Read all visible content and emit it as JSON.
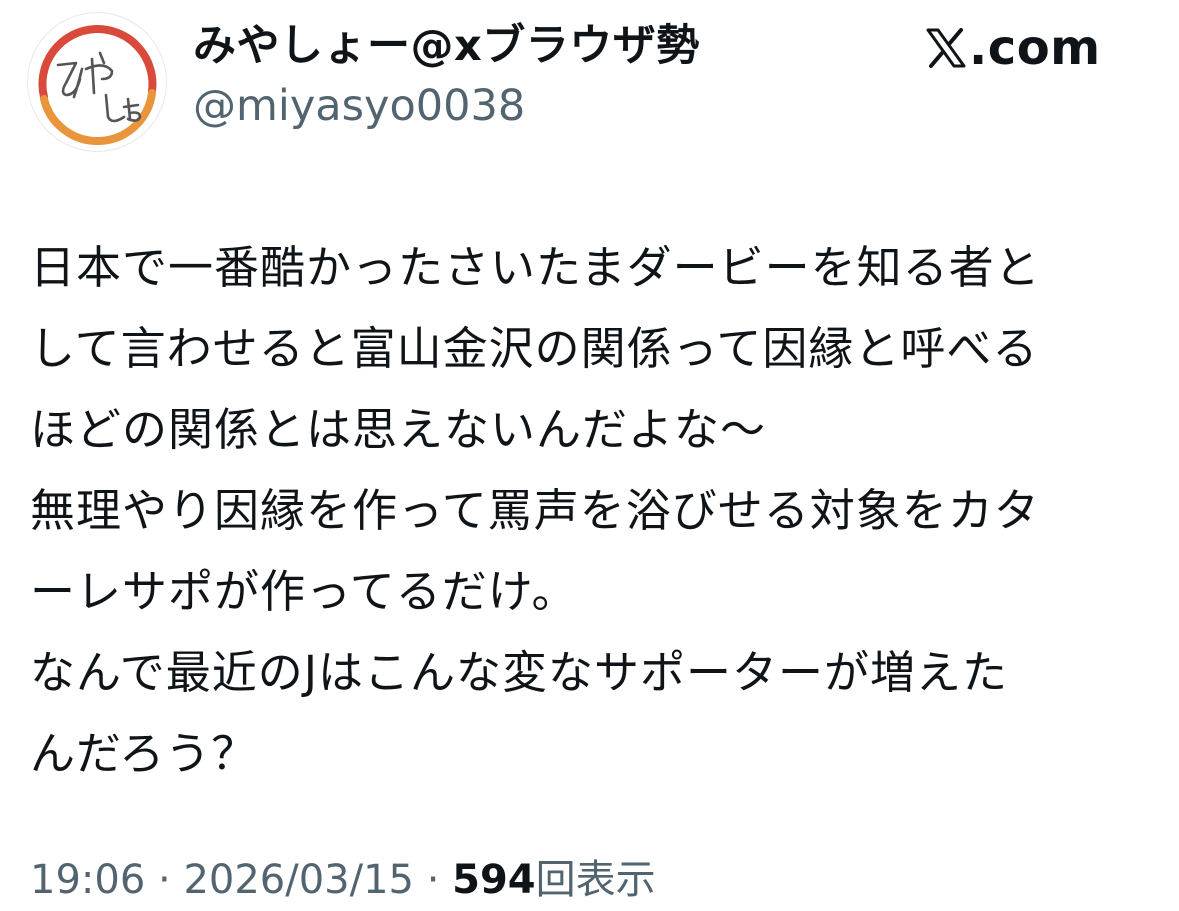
{
  "author": {
    "display_name": "みやしょー@xブラウザ勢",
    "handle": "@miyasyo0038",
    "avatar_text": "みやしょ"
  },
  "site": {
    "name": ".com",
    "logo_icon": "x-logo-icon"
  },
  "tweet": {
    "lines": [
      "日本で一番酷かったさいたまダービーを知る者と",
      "して言わせると富山金沢の関係って因縁と呼べる",
      "ほどの関係とは思えないんだよな〜",
      "無理やり因縁を作って罵声を浴びせる対象をカタ",
      "ーレサポが作ってるだけ。",
      "なんで最近のJはこんな変なサポーターが増えた",
      "んだろう？"
    ]
  },
  "meta": {
    "time": "19:06",
    "separator": " · ",
    "date": "2026/03/15",
    "views_count": "594",
    "views_label": "回表示"
  },
  "colors": {
    "text": "#0f1419",
    "secondary": "#536471",
    "avatar_ring_red": "#d94a3c",
    "avatar_ring_orange": "#e8953b"
  }
}
